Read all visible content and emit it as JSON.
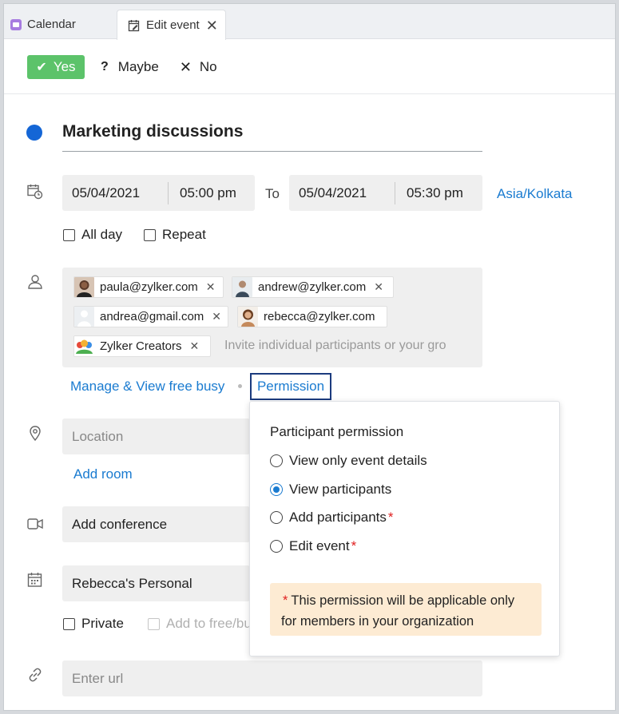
{
  "tabs": {
    "calendar": "Calendar",
    "edit_event": "Edit event"
  },
  "rsvp": {
    "yes": "Yes",
    "maybe": "Maybe",
    "no": "No"
  },
  "event": {
    "title": "Marketing discussions",
    "start_date": "05/04/2021",
    "start_time": "05:00 pm",
    "to_label": "To",
    "end_date": "05/04/2021",
    "end_time": "05:30 pm",
    "timezone": "Asia/Kolkata",
    "all_day": "All day",
    "repeat": "Repeat"
  },
  "participants": {
    "chips": [
      "paula@zylker.com",
      "andrew@zylker.com",
      "andrea@gmail.com",
      "rebecca@zylker.com",
      "Zylker Creators"
    ],
    "invite_placeholder": "Invite individual participants or your gro",
    "manage_link": "Manage & View free busy",
    "permission_button": "Permission"
  },
  "location": {
    "placeholder": "Location",
    "add_room": "Add room"
  },
  "conference": {
    "label": "Add conference"
  },
  "calendar_select": {
    "value": "Rebecca's Personal",
    "private": "Private",
    "free_busy": "Add to free/bu"
  },
  "url": {
    "placeholder": "Enter url"
  },
  "permission_popup": {
    "heading": "Participant permission",
    "options": [
      "View only event details",
      "View participants",
      "Add participants",
      "Edit event"
    ],
    "note_star": "*",
    "note": "This permission will be applicable only for members in your organization"
  }
}
